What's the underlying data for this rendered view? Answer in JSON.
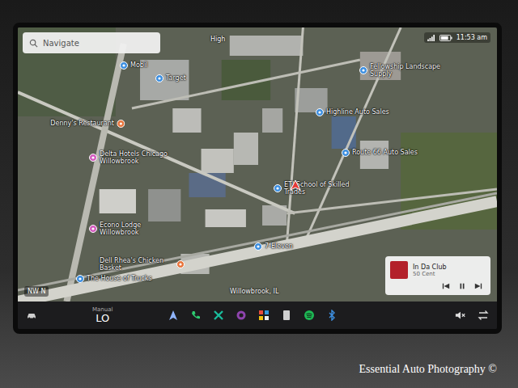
{
  "search": {
    "placeholder": "Navigate"
  },
  "status_bar": {
    "time": "11:53 am"
  },
  "map": {
    "road_label": "High",
    "city_label": "Willowbrook, IL",
    "compass": "NW N",
    "pois": [
      {
        "label": "Mobil",
        "color": "#3d8fe0"
      },
      {
        "label": "Target",
        "color": "#3d8fe0"
      },
      {
        "label": "Denny's Restaurant",
        "color": "#e8743b"
      },
      {
        "label": "Delta Hotels Chicago Willowbrook",
        "color": "#d35bbf"
      },
      {
        "label": "Econo Lodge Willowbrook",
        "color": "#d35bbf"
      },
      {
        "label": "The House of Trucks",
        "color": "#3d8fe0"
      },
      {
        "label": "Highline Auto Sales",
        "color": "#3d8fe0"
      },
      {
        "label": "Dell Rhea's Chicken Basket",
        "color": "#e8743b"
      },
      {
        "label": "ETI School of Skilled Trades",
        "color": "#3d8fe0"
      },
      {
        "label": "Route 66 Auto Sales",
        "color": "#3d8fe0"
      },
      {
        "label": "Fellowship Landscape Supply",
        "color": "#3d8fe0"
      },
      {
        "label": "7-Eleven",
        "color": "#3d8fe0"
      }
    ]
  },
  "media": {
    "title": "In Da Club",
    "artist": "50 Cent",
    "playing": true
  },
  "climate": {
    "mode": "Manual",
    "temperature": "LO"
  },
  "volume": {
    "muted": true
  },
  "watermark": "Essential Auto Photography ©"
}
